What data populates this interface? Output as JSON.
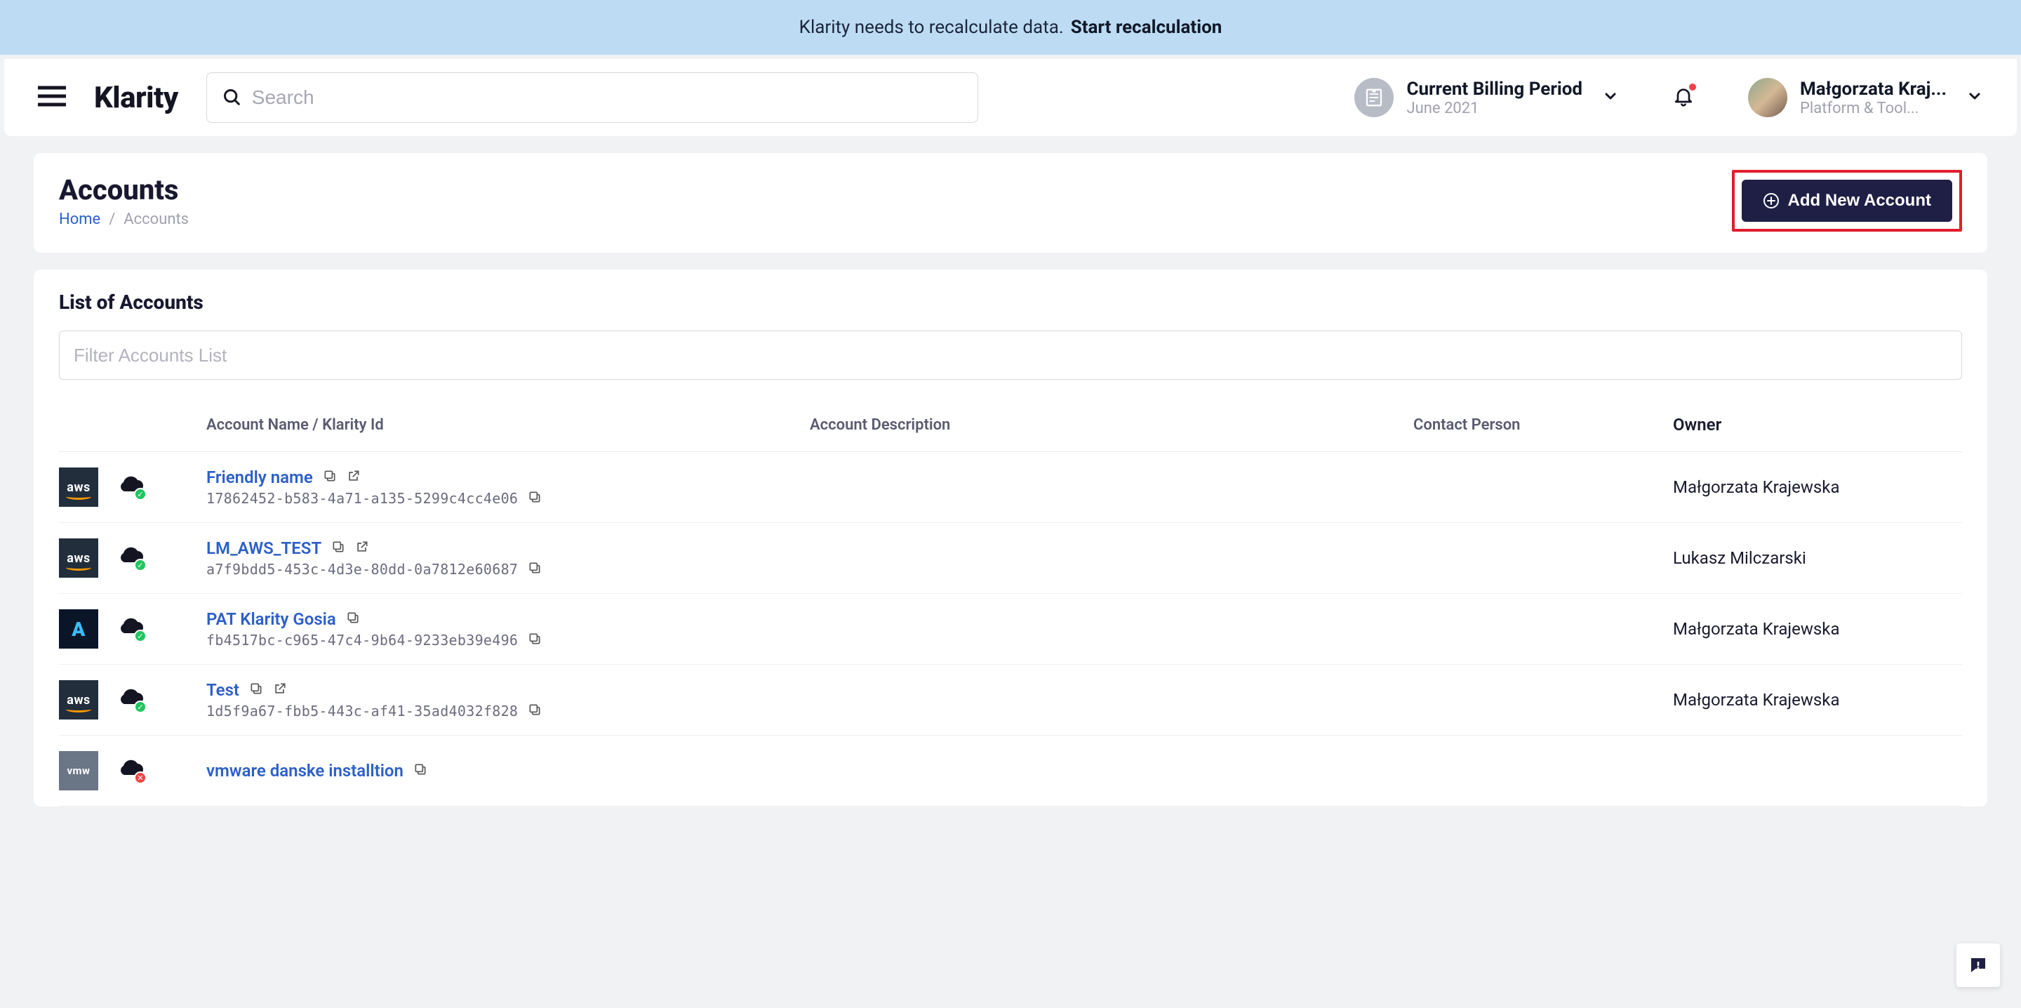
{
  "banner": {
    "message": "Klarity needs to recalculate data.",
    "action": "Start recalculation"
  },
  "header": {
    "brand": "Klarity",
    "search_placeholder": "Search",
    "billing_label": "Current Billing Period",
    "billing_value": "June 2021",
    "user_name": "Małgorzata Kraj...",
    "user_sub": "Platform & Tool..."
  },
  "page": {
    "title": "Accounts",
    "crumb_home": "Home",
    "crumb_sep": "/",
    "crumb_current": "Accounts",
    "add_btn": "Add New Account"
  },
  "list": {
    "title": "List of Accounts",
    "filter_placeholder": "Filter Accounts List",
    "columns": {
      "name": "Account Name / Klarity Id",
      "desc": "Account Description",
      "contact": "Contact Person",
      "owner": "Owner"
    },
    "rows": [
      {
        "provider": "aws",
        "status": "ok",
        "name": "Friendly name",
        "has_ext": true,
        "id": "17862452-b583-4a71-a135-5299c4cc4e06",
        "owner": "Małgorzata Krajewska"
      },
      {
        "provider": "aws",
        "status": "ok",
        "name": "LM_AWS_TEST",
        "has_ext": true,
        "id": "a7f9bdd5-453c-4d3e-80dd-0a7812e60687",
        "owner": "Lukasz Milczarski"
      },
      {
        "provider": "azure",
        "status": "ok",
        "name": "PAT Klarity Gosia",
        "has_ext": false,
        "id": "fb4517bc-c965-47c4-9b64-9233eb39e496",
        "owner": "Małgorzata Krajewska"
      },
      {
        "provider": "aws",
        "status": "ok",
        "name": "Test",
        "has_ext": true,
        "id": "1d5f9a67-fbb5-443c-af41-35ad4032f828",
        "owner": "Małgorzata Krajewska"
      },
      {
        "provider": "vmw",
        "status": "err",
        "name": "vmware danske installtion",
        "has_ext": false,
        "id": "",
        "owner": ""
      }
    ]
  }
}
